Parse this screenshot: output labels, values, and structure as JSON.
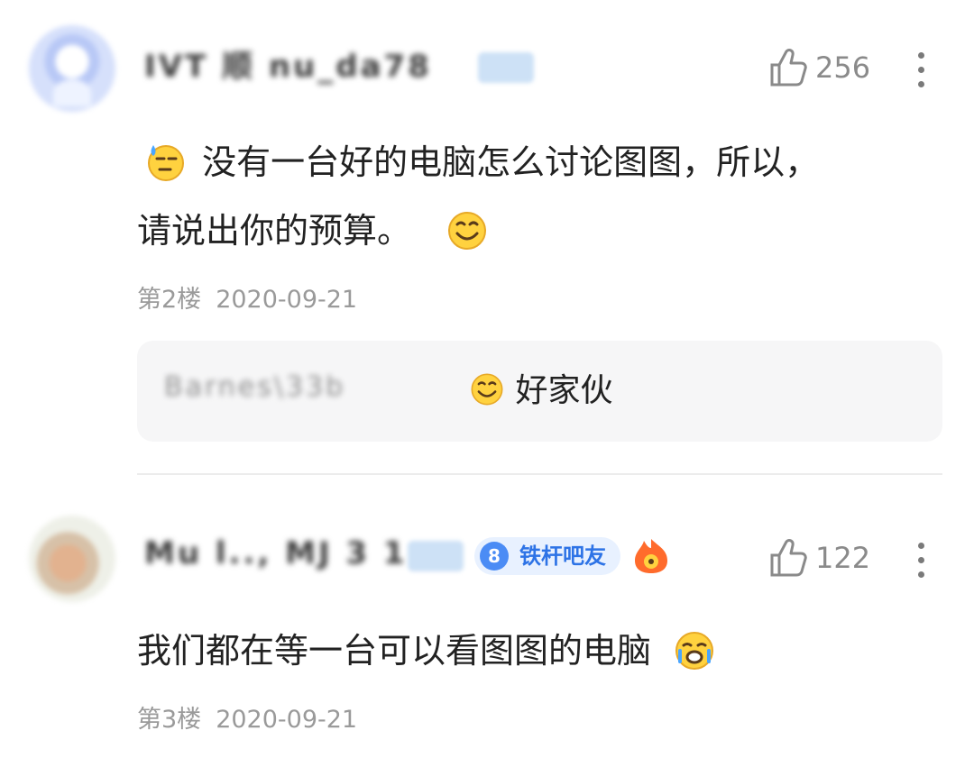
{
  "comments": [
    {
      "username": "IVT 顺 nu_da78",
      "likes": "256",
      "text_line1": "没有一台好的电脑怎么讨论图图，所以，",
      "text_line2": "请说出你的预算。",
      "floor": "第2楼",
      "date": "2020-09-21",
      "reply": {
        "username": "Barnes\\33b",
        "text": "好家伙"
      }
    },
    {
      "username": "Mu l.., MJ 3 1",
      "level": "8",
      "level_label": "铁杆吧友",
      "likes": "122",
      "text": "我们都在等一台可以看图图的电脑",
      "floor": "第3楼",
      "date": "2020-09-21"
    }
  ],
  "icons": {
    "like": "thumbs-up-icon",
    "more": "more-vertical-icon",
    "emoji_sweat": "sweat-thinking-emoji",
    "emoji_smile": "smile-emoji",
    "emoji_cry": "crying-emoji",
    "badge_fire": "fire-badge-icon"
  }
}
